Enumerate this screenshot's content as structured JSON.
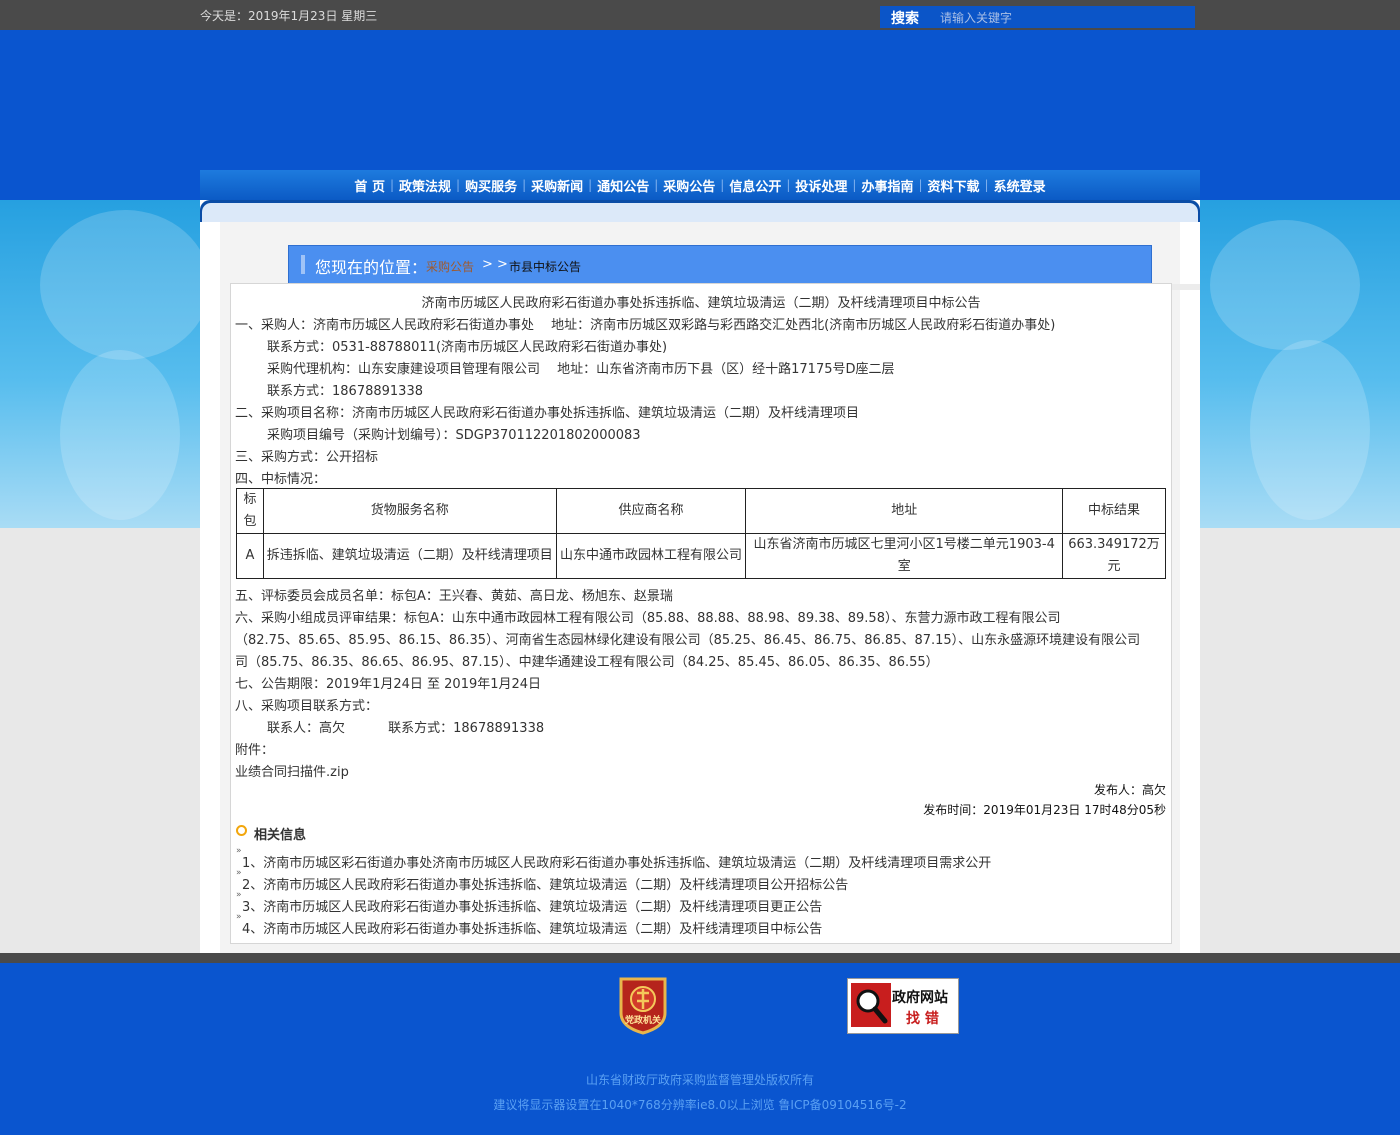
{
  "topbar": {
    "date_text": "今天是：2019年1月23日 星期三",
    "search_label": "搜索",
    "search_placeholder": "请输入关键字"
  },
  "nav": {
    "items": [
      "首 页",
      "政策法规",
      "购买服务",
      "采购新闻",
      "通知公告",
      "采购公告",
      "信息公开",
      "投诉处理",
      "办事指南",
      "资料下载",
      "系统登录"
    ]
  },
  "breadcrumb": {
    "title": "您现在的位置：",
    "link": "采购公告",
    "arrow": "> >",
    "current": "市县中标公告"
  },
  "article": {
    "title": "济南市历城区人民政府彩石街道办事处拆违拆临、建筑垃圾清运（二期）及杆线清理项目中标公告",
    "lines": [
      "一、采购人：济南市历城区人民政府彩石街道办事处 　地址：济南市历城区双彩路与彩西路交汇处西北(济南市历城区人民政府彩石街道办事处)",
      "联系方式：0531-88788011(济南市历城区人民政府彩石街道办事处)",
      "采购代理机构：山东安康建设项目管理有限公司 　地址：山东省济南市历下县（区）经十路17175号D座二层",
      "联系方式：18678891338",
      "二、采购项目名称：济南市历城区人民政府彩石街道办事处拆违拆临、建筑垃圾清运（二期）及杆线清理项目",
      "采购项目编号（采购计划编号）：SDGP370112201802000083",
      "三、采购方式：公开招标",
      "四、中标情况："
    ],
    "table": {
      "headers": [
        "标包",
        "货物服务名称",
        "供应商名称",
        "地址",
        "中标结果"
      ],
      "rows": [
        [
          "A",
          "拆违拆临、建筑垃圾清运（二期）及杆线清理项目",
          "山东中通市政园林工程有限公司",
          "山东省济南市历城区七里河小区1号楼二单元1903-4室",
          "663.349172万元"
        ]
      ]
    },
    "lines_after": [
      "五、评标委员会成员名单：标包A：王兴春、黄茹、高日龙、杨旭东、赵景瑞",
      "六、采购小组成员评审结果：标包A：山东中通市政园林工程有限公司（85.88、88.88、88.98、89.38、89.58）、东营力源市政工程有限公司",
      "（82.75、85.65、85.95、86.15、86.35）、河南省生态园林绿化建设有限公司（85.25、86.45、86.75、86.85、87.15）、山东永盛源环境建设有限公司",
      "司（85.75、86.35、86.65、86.95、87.15）、中建华通建设工程有限公司（84.25、85.45、86.05、86.35、86.55）",
      "七、公告期限：2019年1月24日 至 2019年1月24日",
      "八、采购项目联系方式：",
      "联系人：高欠 　　　联系方式：18678891338",
      "附件：",
      "业绩合同扫描件.zip"
    ],
    "publisher": "发布人：高欠",
    "publish_time": "发布时间：2019年01月23日 17时48分05秒"
  },
  "related": {
    "heading": "相关信息",
    "items": [
      "1、济南市历城区彩石街道办事处济南市历城区人民政府彩石街道办事处拆违拆临、建筑垃圾清运（二期）及杆线清理项目需求公开",
      "2、济南市历城区人民政府彩石街道办事处拆违拆临、建筑垃圾清运（二期）及杆线清理项目公开招标公告",
      "3、济南市历城区人民政府彩石街道办事处拆违拆临、建筑垃圾清运（二期）及杆线清理项目更正公告",
      "4、济南市历城区人民政府彩石街道办事处拆违拆临、建筑垃圾清运（二期）及杆线清理项目中标公告"
    ]
  },
  "footer": {
    "emblem_text": "党政机关",
    "gov_title": "政府网站",
    "gov_action": "找 错",
    "copyright": "山东省财政厅政府采购监督管理处版权所有",
    "advice": "建议将显示器设置在1040*768分辨率ie8.0以上浏览 鲁ICP备09104516号-2"
  },
  "colors": {
    "brand_blue": "#0a55cf",
    "accent_orange": "#f2a60c",
    "emblem_red": "#c81e1e"
  }
}
